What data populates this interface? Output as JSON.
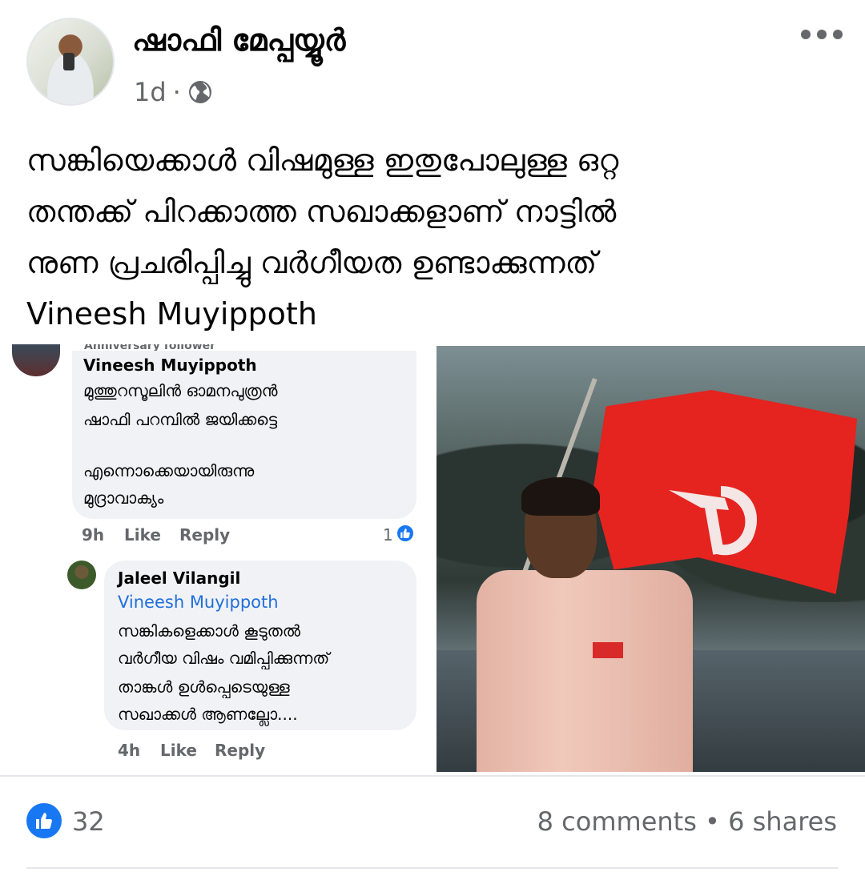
{
  "post": {
    "author": "ഷാഫി മേപ്പയ്യൂർ",
    "time": "1d",
    "separator": "·",
    "privacy_icon": "globe-icon",
    "text_lines": [
      "സങ്കിയെക്കാൾ വിഷമുള്ള ഇതുപോലുള്ള ഒറ്റ",
      "തന്തക്ക് പിറക്കാത്ത സഖാക്കളാണ് നാട്ടിൽ",
      "നുണ പ്രചരിപ്പിച്ചു വർഗീയത ഉണ്ടാക്കുന്നത്",
      "Vineesh  Muyippoth"
    ]
  },
  "screenshot": {
    "badge": "Anniversary follower",
    "comment1": {
      "name": "Vineesh Muyippoth",
      "lines": [
        "മുത്തുറസൂലിൻ ഓമനപുത്രൻ",
        "ഷാഫി പറമ്പിൽ ജയിക്കട്ടെ",
        "",
        "എന്നൊക്കെയായിരുന്നു",
        "മുദ്രാവാക്യം"
      ],
      "time": "9h",
      "like": "Like",
      "reply": "Reply",
      "reactions": "1"
    },
    "comment2": {
      "name": "Jaleel Vilangil",
      "mention": "Vineesh Muyippoth",
      "lines": [
        "സങ്കികളെക്കാൾ കൂടുതൽ",
        "വർഗീയ വിഷം വമിപ്പിക്കുന്നത്",
        "താങ്കൾ ഉൾപ്പെടെയുള്ള",
        "സഖാക്കൾ ആണല്ലോ...."
      ],
      "time": "4h",
      "like": "Like",
      "reply": "Reply"
    }
  },
  "footer": {
    "like_count": "32",
    "comments": "8 comments",
    "dot": "•",
    "shares": "6 shares"
  },
  "colors": {
    "accent": "#1877f2",
    "secondary_text": "#65676b",
    "flag_red": "#e5231f"
  }
}
